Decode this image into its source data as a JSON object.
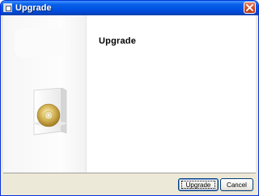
{
  "window": {
    "title": "Upgrade"
  },
  "main": {
    "heading": "Upgrade"
  },
  "icons": {
    "app": "app-icon",
    "close": "close-icon",
    "product": "software-box-cd-icon"
  },
  "buttons": {
    "upgrade_label": "Upgrade",
    "cancel_label": "Cancel"
  },
  "colors": {
    "titlebar": "#0054e3",
    "close": "#c94a2b",
    "dialog_bg": "#ece9d8"
  }
}
